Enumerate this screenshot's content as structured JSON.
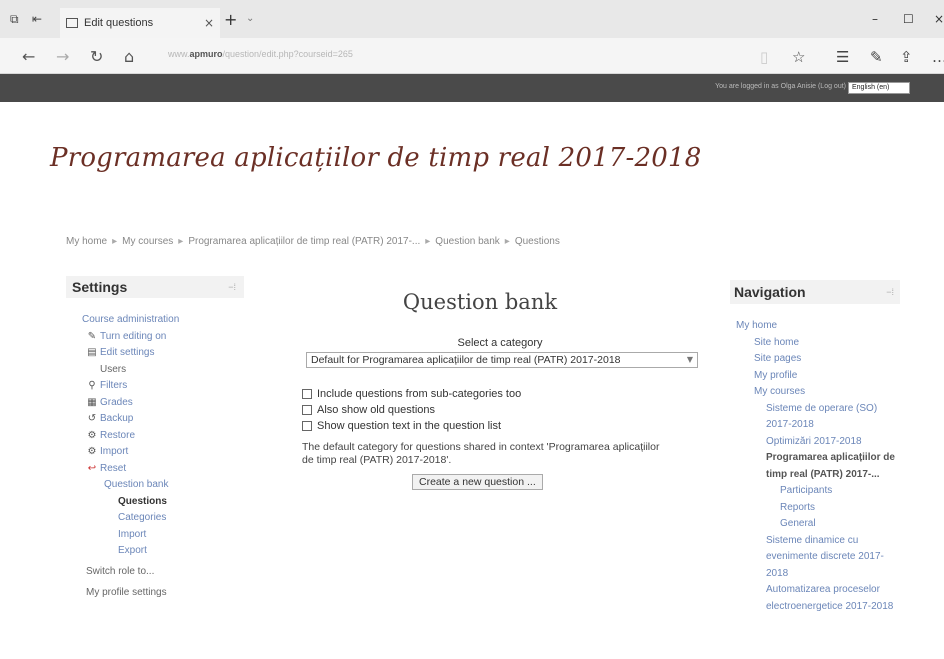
{
  "browser": {
    "tab_title": "Edit questions",
    "tab_close": "×",
    "new_tab": "+",
    "url_host": "apmuro",
    "url_prefix": "www.",
    "url_rest": "/question/edit.php?courseid=265"
  },
  "site": {
    "login_info": "You are logged in as Olga Anisie (Log out)",
    "language": "English (en)"
  },
  "course_title": "Programarea aplicațiilor de timp real 2017-2018",
  "breadcrumb": [
    "My home",
    "My courses",
    "Programarea aplicațiilor de timp real (PATR) 2017-...",
    "Question bank",
    "Questions"
  ],
  "settings": {
    "title": "Settings",
    "items": [
      {
        "label": "Course administration",
        "icon": ""
      },
      {
        "label": "Turn editing on",
        "icon": "✎"
      },
      {
        "label": "Edit settings",
        "icon": "▤"
      },
      {
        "label": "Users",
        "icon": ""
      },
      {
        "label": "Filters",
        "icon": "⚲"
      },
      {
        "label": "Grades",
        "icon": "▦"
      },
      {
        "label": "Backup",
        "icon": "↺"
      },
      {
        "label": "Restore",
        "icon": "⚙"
      },
      {
        "label": "Import",
        "icon": "⚙"
      },
      {
        "label": "Reset",
        "icon": "↩"
      },
      {
        "label": "Question bank",
        "icon": ""
      },
      {
        "label": "Questions",
        "icon": ""
      },
      {
        "label": "Categories",
        "icon": ""
      },
      {
        "label": "Import",
        "icon": ""
      },
      {
        "label": "Export",
        "icon": ""
      },
      {
        "label": "Switch role to...",
        "icon": ""
      },
      {
        "label": "My profile settings",
        "icon": ""
      }
    ]
  },
  "main": {
    "title": "Question bank",
    "select_label": "Select a category",
    "category_value": "Default for Programarea aplicațiilor de timp real (PATR) 2017-2018",
    "options": [
      "Include questions from sub-categories too",
      "Also show old questions",
      "Show question text in the question list"
    ],
    "note": "The default category for questions shared in context 'Programarea aplicațiilor de timp real (PATR) 2017-2018'.",
    "create_button": "Create a new question ..."
  },
  "navigation": {
    "title": "Navigation",
    "items": [
      "My home",
      "Site home",
      "Site pages",
      "My profile",
      "My courses",
      "Sisteme de operare (SO) 2017-2018",
      "Optimizări 2017-2018",
      "Programarea aplicațiilor de timp real (PATR) 2017-...",
      "Participants",
      "Reports",
      "General",
      "Sisteme dinamice cu evenimente discrete 2017-2018",
      "Automatizarea proceselor electroenergetice 2017-2018"
    ]
  },
  "colors": {
    "course_title": "#6b2f25",
    "link": "#6b86b8",
    "top_bar": "#4a4a4a"
  }
}
